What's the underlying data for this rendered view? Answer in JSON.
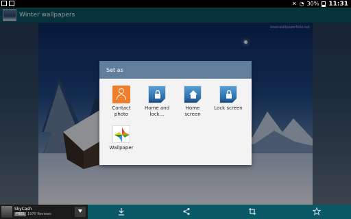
{
  "statusbar": {
    "battery": "30%",
    "time": "11:31"
  },
  "appbar": {
    "title": "Winter wallpapers"
  },
  "wallpaper": {
    "watermark": "www.wallpaperfolio.net"
  },
  "dialog": {
    "title": "Set as",
    "options": [
      {
        "label_line1": "Contact",
        "label_line2": "photo",
        "icon": "contact-icon"
      },
      {
        "label_line1": "Home and",
        "label_line2": "lock...",
        "icon": "lock-icon"
      },
      {
        "label_line1": "Home",
        "label_line2": "screen",
        "icon": "home-icon"
      },
      {
        "label_line1": "Lock screen",
        "label_line2": "",
        "icon": "lock-icon"
      },
      {
        "label_line1": "Wallpaper",
        "label_line2": "",
        "icon": "photos-icon"
      }
    ]
  },
  "ad": {
    "app_name": "SkyCash",
    "badge": "FREE",
    "reviews": "1970 Reviews"
  },
  "bottombar": {
    "icons": [
      "download-icon",
      "share-icon",
      "crop-icon",
      "star-icon"
    ]
  }
}
